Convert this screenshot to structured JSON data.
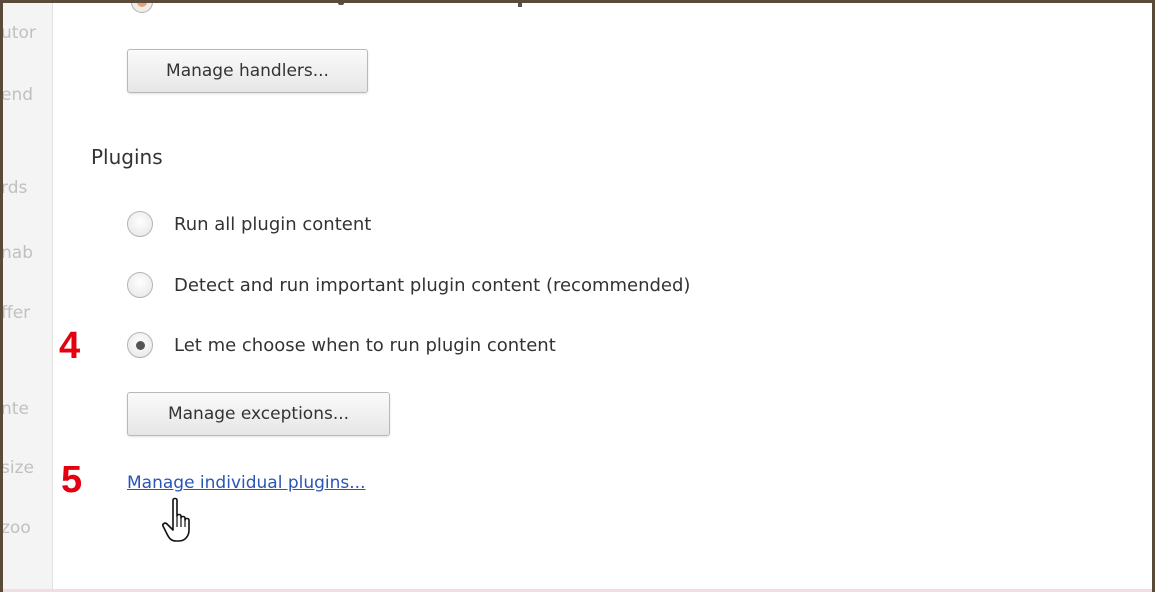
{
  "sidebar": {
    "items": [
      "utor",
      "end",
      "rds",
      "nab",
      "ffer",
      "nte",
      "size",
      "zoo"
    ]
  },
  "handlers": {
    "button_label": "Manage handlers..."
  },
  "plugins": {
    "title": "Plugins",
    "options": [
      {
        "label": "Run all plugin content",
        "checked": false
      },
      {
        "label": "Detect and run important plugin content (recommended)",
        "checked": false
      },
      {
        "label": "Let me choose when to run plugin content",
        "checked": true
      }
    ],
    "exceptions_button_label": "Manage exceptions...",
    "individual_link_label": "Manage individual plugins..."
  },
  "annotations": {
    "step_4": "4",
    "step_5": "5",
    "color": "#e3000f"
  },
  "icons": {
    "cursor": "hand-pointer-icon"
  }
}
